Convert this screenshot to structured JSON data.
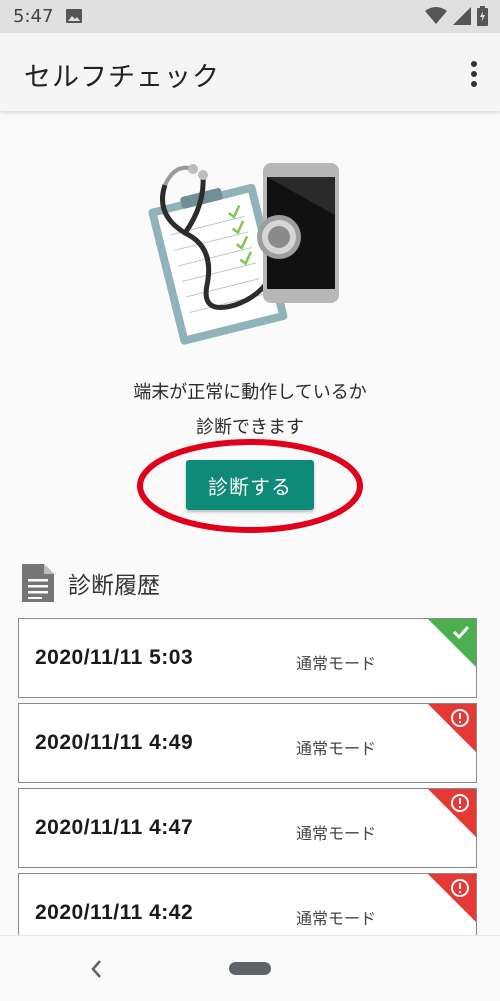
{
  "status_bar": {
    "time": "5:47",
    "icons": [
      "image-icon",
      "wifi-icon",
      "signal-icon",
      "battery-icon"
    ]
  },
  "app_bar": {
    "title": "セルフチェック",
    "menu_icon": "overflow-menu-icon"
  },
  "hero": {
    "illustration": "clipboard-stethoscope-phone-illustration"
  },
  "description": {
    "line1": "端末が正常に動作しているか",
    "line2": "診断できます"
  },
  "diagnose_button": {
    "label": "診断する",
    "color": "#0e8a78",
    "highlight_color": "#e0001b"
  },
  "history": {
    "title": "診断履歴",
    "icon": "document-icon",
    "items": [
      {
        "date": "2020/11/11 5:03",
        "mode": "通常モード",
        "status": "ok",
        "badge_color": "#4caf50",
        "badge_icon": "check-icon"
      },
      {
        "date": "2020/11/11 4:49",
        "mode": "通常モード",
        "status": "error",
        "badge_color": "#e53935",
        "badge_icon": "alert-icon"
      },
      {
        "date": "2020/11/11 4:47",
        "mode": "通常モード",
        "status": "error",
        "badge_color": "#e53935",
        "badge_icon": "alert-icon"
      },
      {
        "date": "2020/11/11 4:42",
        "mode": "通常モード",
        "status": "error",
        "badge_color": "#e53935",
        "badge_icon": "alert-icon"
      }
    ]
  },
  "nav_bar": {
    "back_icon": "back-chevron-icon",
    "home_icon": "home-pill-icon"
  }
}
